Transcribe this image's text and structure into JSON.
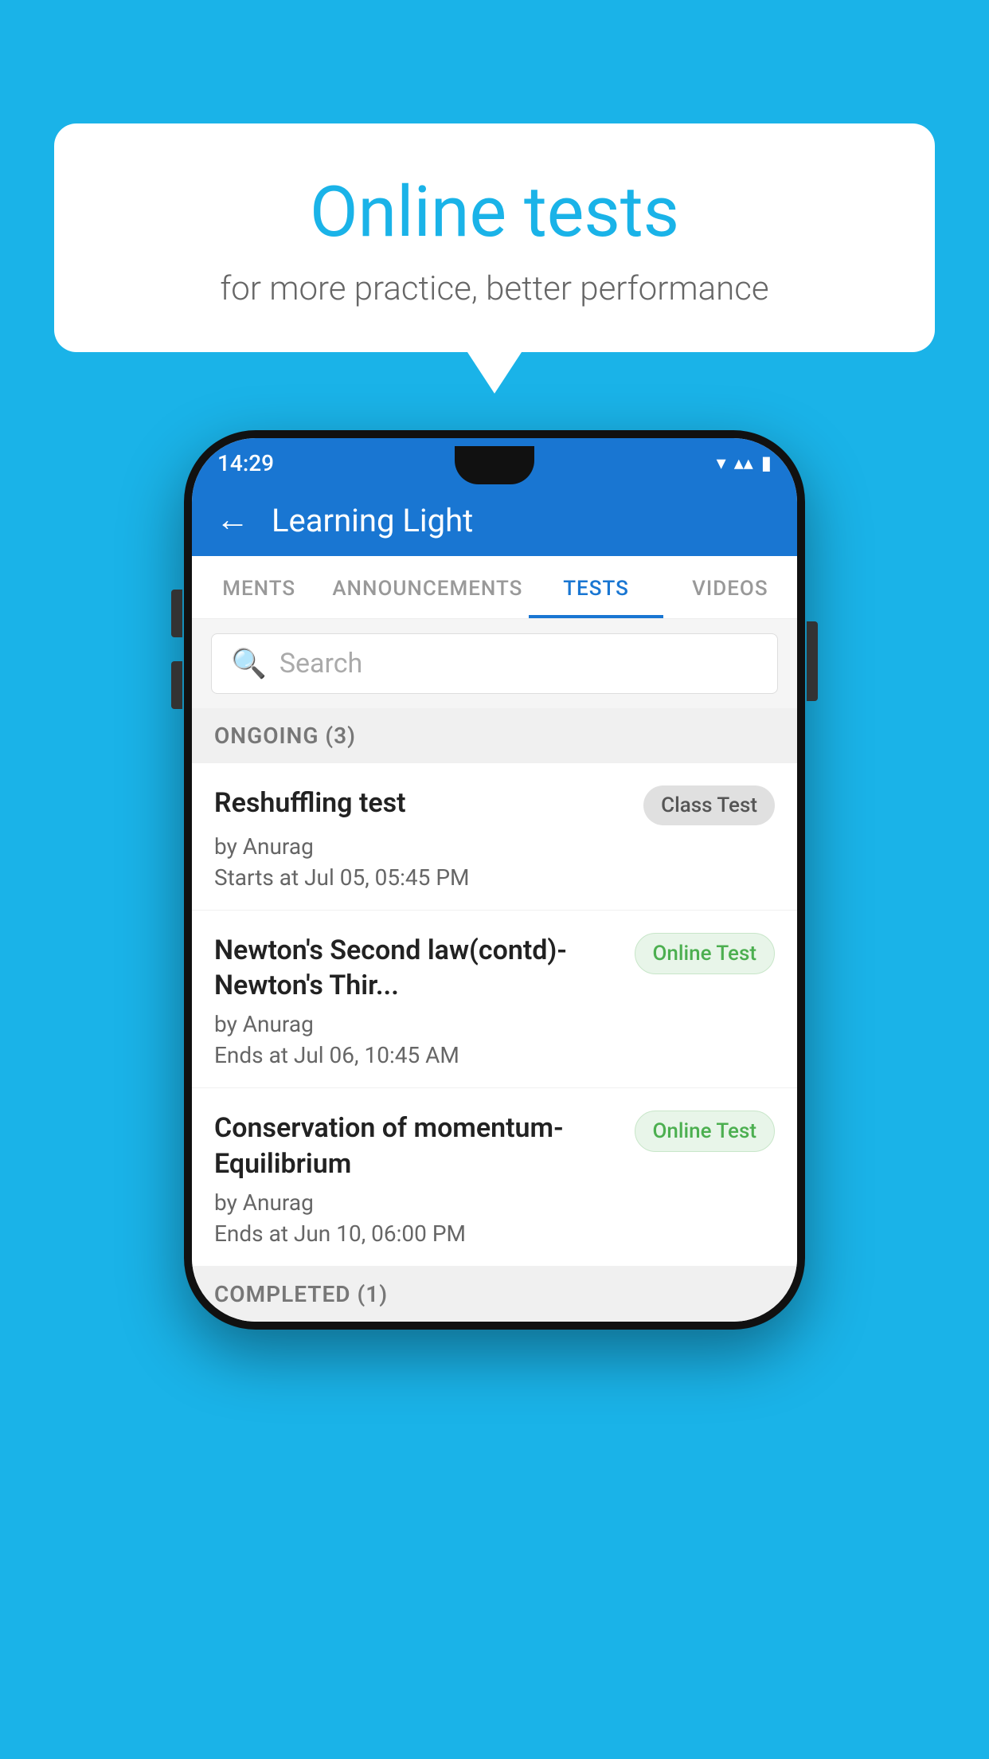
{
  "background": {
    "color": "#1ab3e8"
  },
  "bubble": {
    "title": "Online tests",
    "subtitle": "for more practice, better performance"
  },
  "phone": {
    "status_bar": {
      "time": "14:29",
      "icons": "▼◀▮"
    },
    "header": {
      "back_label": "←",
      "title": "Learning Light"
    },
    "tabs": [
      {
        "label": "MENTS",
        "active": false
      },
      {
        "label": "ANNOUNCEMENTS",
        "active": false
      },
      {
        "label": "TESTS",
        "active": true
      },
      {
        "label": "VIDEOS",
        "active": false
      }
    ],
    "search": {
      "placeholder": "Search"
    },
    "ongoing_section": {
      "label": "ONGOING (3)"
    },
    "tests": [
      {
        "name": "Reshuffling test",
        "badge": "Class Test",
        "badge_type": "class",
        "author": "by Anurag",
        "time_label": "Starts at",
        "time_value": "Jul 05, 05:45 PM"
      },
      {
        "name": "Newton's Second law(contd)-Newton's Thir...",
        "badge": "Online Test",
        "badge_type": "online",
        "author": "by Anurag",
        "time_label": "Ends at",
        "time_value": "Jul 06, 10:45 AM"
      },
      {
        "name": "Conservation of momentum-Equilibrium",
        "badge": "Online Test",
        "badge_type": "online",
        "author": "by Anurag",
        "time_label": "Ends at",
        "time_value": "Jun 10, 06:00 PM"
      }
    ],
    "completed_section": {
      "label": "COMPLETED (1)"
    }
  }
}
